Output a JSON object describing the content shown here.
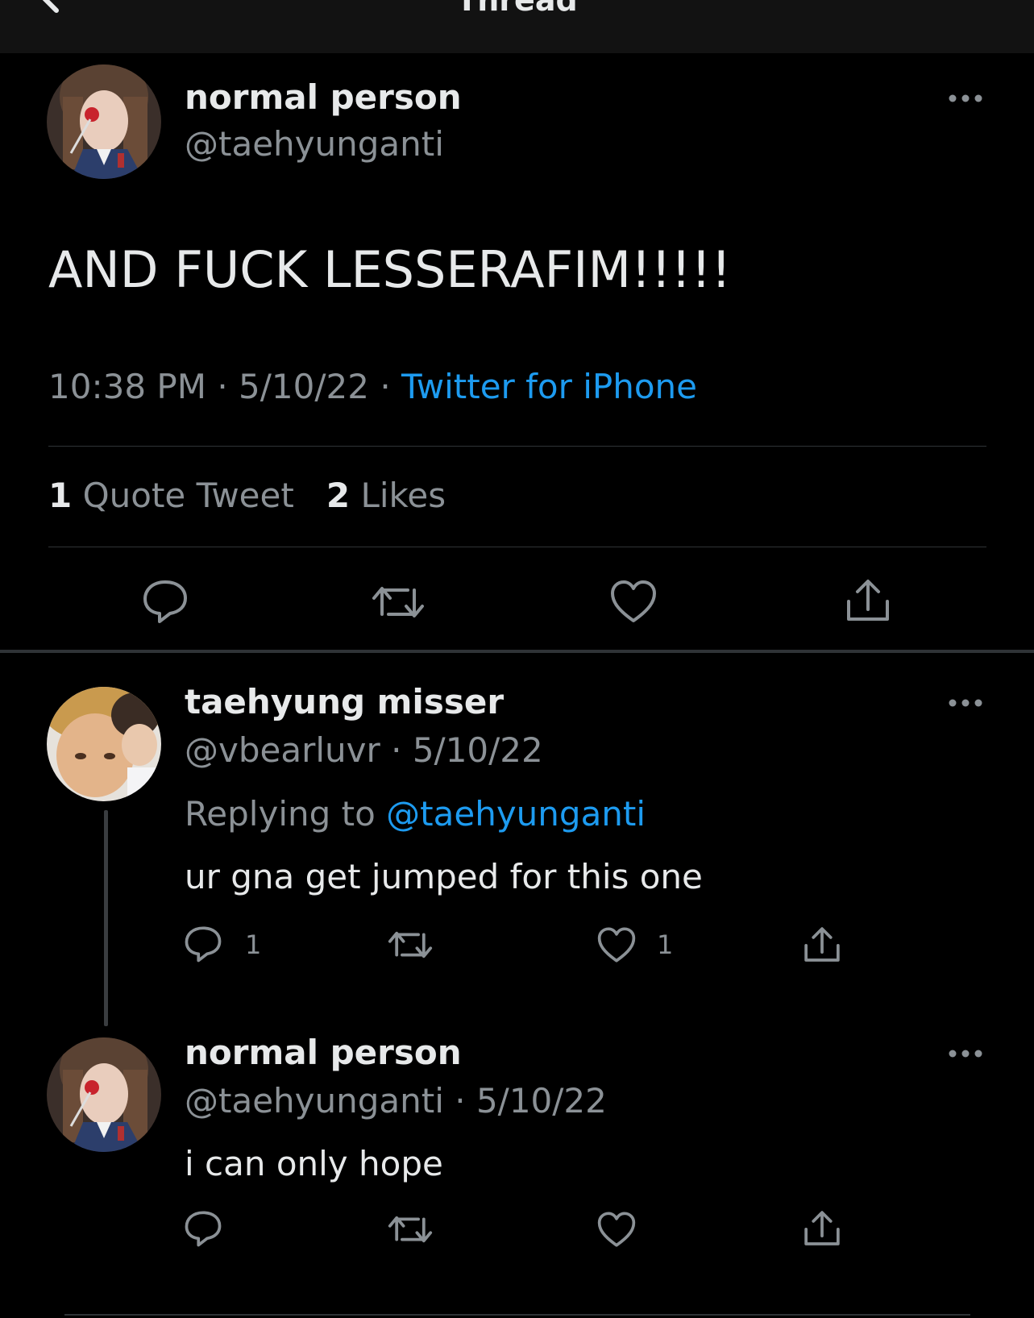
{
  "header": {
    "title": "Thread"
  },
  "main_tweet": {
    "name": "normal person",
    "handle": "@taehyunganti",
    "text": "AND FUCK LESSERAFIM!!!!!",
    "time": "10:38 PM",
    "separator": "·",
    "date": "5/10/22",
    "source": "Twitter for iPhone",
    "quote_count": "1",
    "quote_label": "Quote Tweet",
    "like_count": "2",
    "like_label": "Likes"
  },
  "replies": [
    {
      "name": "taehyung misser",
      "handle_line": "@vbearluvr · 5/10/22",
      "replying_prefix": "Replying to",
      "replying_mention": "@taehyunganti",
      "text": "ur gna get jumped for this one",
      "reply_count": "1",
      "like_count": "1"
    },
    {
      "name": "normal person",
      "handle_line": "@taehyunganti · 5/10/22",
      "text": "i can only hope"
    }
  ],
  "colors": {
    "background": "#000000",
    "accent": "#1d9bf0",
    "muted": "#8b9196",
    "text": "#e7e9ea"
  },
  "icons": [
    "back-arrow-icon",
    "more-icon",
    "reply-icon",
    "retweet-icon",
    "like-icon",
    "share-icon"
  ]
}
